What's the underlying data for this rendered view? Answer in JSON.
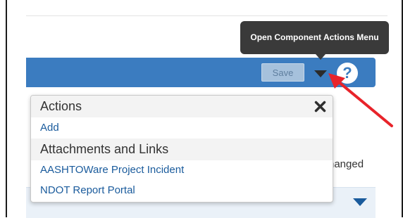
{
  "tooltip": {
    "text": "Open Component Actions Menu"
  },
  "toolbar": {
    "save_label": "Save",
    "help_label": "?"
  },
  "background_text": {
    "changed": "hanged"
  },
  "menu": {
    "sections": [
      {
        "header": "Actions",
        "items": [
          "Add"
        ]
      },
      {
        "header": "Attachments and Links",
        "items": [
          "AASHTOWare Project Incident",
          "NDOT Report Portal"
        ]
      }
    ]
  },
  "icons": {
    "menu_toggle": "caret-down-icon",
    "help": "question-circle-icon",
    "close": "close-x-icon",
    "callout": "red-arrow-icon",
    "panel_toggle": "chevron-down-icon"
  },
  "colors": {
    "toolbar": "#3b7cc0",
    "tooltip": "#3a3a3a",
    "link": "#1a5b9c",
    "arrow": "#e8232a"
  }
}
